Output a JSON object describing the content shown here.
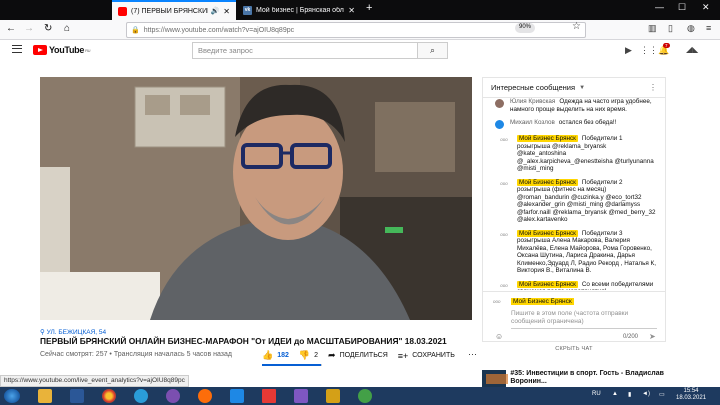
{
  "browser": {
    "tabs": [
      {
        "title": "(7) ПЕРВЫЙ БРЯНСКИЙ С",
        "audio": true,
        "active": true
      },
      {
        "title": "Мой бизнес | Брянская облас",
        "audio": false,
        "active": false
      }
    ],
    "url": "https://www.youtube.com/watch?v=ajOIU8q89pc",
    "zoom": "90%"
  },
  "youtube": {
    "logo": "YouTube",
    "region": "RU",
    "search_placeholder": "Введите запрос",
    "notifications_count": "7"
  },
  "video": {
    "location": "УЛ. БЕЖИЦКАЯ, 54",
    "title": "ПЕРВЫЙ БРЯНСКИЙ ОНЛАЙН БИЗНЕС-МАРАФОН \"От ИДЕИ до МАСШТАБИРОВАНИЯ\" 18.03.2021",
    "meta": "Сейчас смотрят: 257 • Трансляция началась 5 часов назад",
    "likes": "182",
    "dislikes": "2",
    "share_label": "ПОДЕЛИТЬСЯ",
    "save_label": "СОХРАНИТЬ",
    "like_ratio": 0.99
  },
  "chat": {
    "header": "Интересные сообщения",
    "messages": [
      {
        "author": "Юлия Кривская",
        "text": "Одеждa на часто игра удобнее, намного проще выделить на них время.",
        "avatar_color": "#8d6e63",
        "owner": false
      },
      {
        "author": "Михаил Козлов",
        "text": "остался без обеда!!",
        "avatar_color": "#1e88e5",
        "owner": false
      },
      {
        "author": "Мой Бизнес Брянск",
        "text": "Победители 1 розыгрыша @reklama_bryansk @kate_antoshina @_alex.karpicheva_@enestteisha @turlyunanna @misti_ming",
        "owner": true
      },
      {
        "author": "Мой Бизнес Брянск",
        "text": "Победители 2 розыгрыша (фитнес на месяц) @roman_bandurin @cuzinka.y @eco_tort32 @alexander_grin @misti_ming @darlamyss @farfor.naill @reklama_bryansk @med_berry_32 @alex.kartavenko",
        "owner": true
      },
      {
        "author": "Мой Бизнес Брянск",
        "text": "Победители 3 розыгрыша Алена Макарова, Валерия Михалёва, Елена Майорова, Рома Горовенко, Оксана Шутина, Лариса Дракина, Дарья Клименко,Эдуард Л, Радио Рекорд , Наталья К, Виктория В., Виталина В.",
        "owner": true
      },
      {
        "author": "Мой Бизнес Брянск",
        "text": "Со всеми победителями свяжемся после мероприятия!",
        "owner": true
      }
    ],
    "compose_author": "Мой Бизнес Брянск",
    "compose_placeholder": "Пишите в этом поле (частота отправки сообщений ограничена)",
    "counter": "0/200",
    "hide_label": "СКРЫТЬ ЧАТ"
  },
  "recommendation": {
    "title": "#35: Инвестиции в спорт. Гость - Владислав Воронин..."
  },
  "status_url": "https://www.youtube.com/live_event_analytics?v=ajOIU8q89pc",
  "taskbar": {
    "lang": "RU",
    "time": "15:54",
    "date": "18.03.2021"
  }
}
